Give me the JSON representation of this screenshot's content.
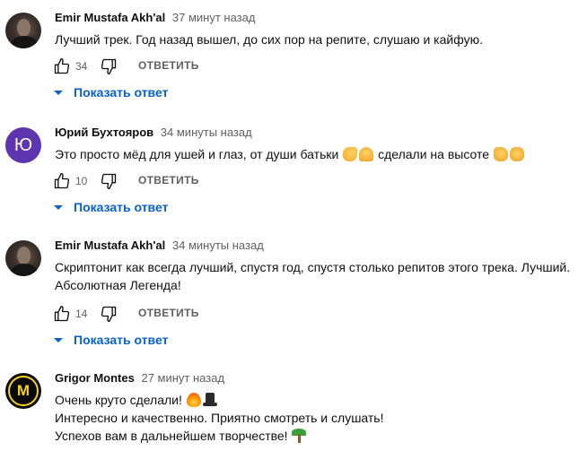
{
  "comments": [
    {
      "author": "Emir Mustafa Akh'al",
      "time": "37 минут назад",
      "avatar": "photo",
      "lines": [
        "Лучший трек. Год назад вышел, до сих пор на репите, слушаю и кайфую."
      ],
      "likes": "34",
      "reply_label": "ОТВЕТИТЬ",
      "show_replies_label": "Показать ответ"
    },
    {
      "author": "Юрий Бухтояров",
      "time": "34 минуты назад",
      "avatar": "letter",
      "avatar_letter": "Ю",
      "avatar_color": "#5e35b1",
      "line_a": "Это просто мёд для ушей и глаз, от души батьки",
      "line_b": "сделали на высоте",
      "emojis": [
        "flexed-biceps-emoji",
        "folded-hands-emoji",
        "thumbs-up-emoji",
        "raised-fist-emoji"
      ],
      "likes": "10",
      "reply_label": "ОТВЕТИТЬ",
      "show_replies_label": "Показать ответ"
    },
    {
      "author": "Emir Mustafa Akh'al",
      "time": "34 минуты назад",
      "avatar": "photo",
      "lines": [
        "Скриптонит как всегда лучший, спустя год, спустя столько репитов этого трека. Лучший.",
        "Абсолютная Легенда!"
      ],
      "likes": "14",
      "reply_label": "ОТВЕТИТЬ",
      "show_replies_label": "Показать ответ"
    },
    {
      "author": "Grigor Montes",
      "time": "27 минут назад",
      "avatar": "logo",
      "avatar_letter": "M",
      "avatar_color": "#f4d21c",
      "lines": [
        "Очень круто сделали!",
        "Интересно и качественно. Приятно смотреть и слушать!",
        "Успехов вам в дальнейшем творчестве!"
      ],
      "emojis": [
        "fire-emoji",
        "top-hat-emoji",
        "palm-tree-emoji"
      ]
    }
  ],
  "colors": {
    "link": "#065fd4",
    "secondary_text": "#606060",
    "primary_text": "#0f0f0f"
  },
  "icons": [
    "thumbs-up-icon",
    "thumbs-down-icon",
    "caret-down-icon"
  ]
}
